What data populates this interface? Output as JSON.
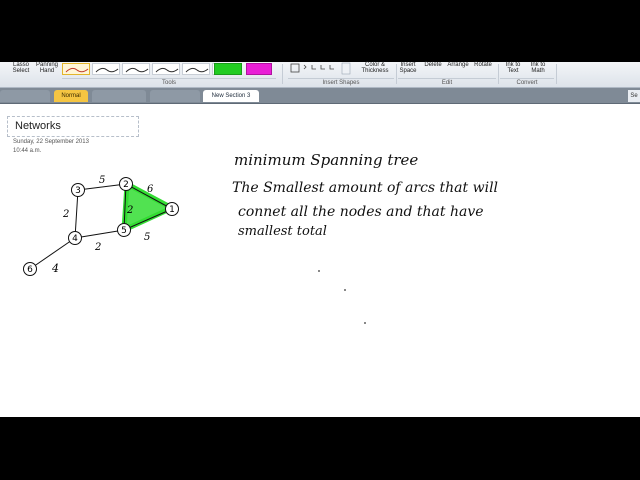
{
  "ribbon": {
    "lasso_select": "Lasso Select",
    "panning_hand": "Panning Hand",
    "tools_label": "Tools",
    "color_thickness": "Color & Thickness",
    "insert_shapes_label": "Insert Shapes",
    "insert_space": "Insert Space",
    "delete": "Delete",
    "arrange": "Arrange",
    "rotate": "Rotate",
    "edit_label": "Edit",
    "ink_to_text": "Ink to Text",
    "ink_to_math": "Ink to Math",
    "convert_label": "Convert",
    "pen_colors": [
      "#c0392b",
      "#2a2a2a",
      "#2a2a2a",
      "#2a2a2a",
      "#2a2a2a",
      "#2a2a2a"
    ],
    "highlighter_green": "#22cc22",
    "highlighter_magenta": "#e91ed6"
  },
  "tabs": {
    "normal": "Normal",
    "active": "New Section 3",
    "search": "Se"
  },
  "page": {
    "title": "Networks",
    "date": "Sunday, 22 September  2013",
    "time": "10:44 a.m."
  },
  "notes": {
    "heading": "minimum Spanning   tree",
    "line1": "The Smallest amount of arcs   that will",
    "line2": "connet all the nodes and that have",
    "line3": "smallest total"
  },
  "graph": {
    "nodes": [
      {
        "label": "1"
      },
      {
        "label": "2"
      },
      {
        "label": "3"
      },
      {
        "label": "4"
      },
      {
        "label": "5"
      },
      {
        "label": "6"
      }
    ],
    "edge_weights": {
      "e32": "5",
      "e21": "6",
      "e25": "2",
      "e34": "2",
      "e45": "2",
      "e51": "5",
      "e46": "4"
    },
    "highlight_color": "#33dd33"
  }
}
